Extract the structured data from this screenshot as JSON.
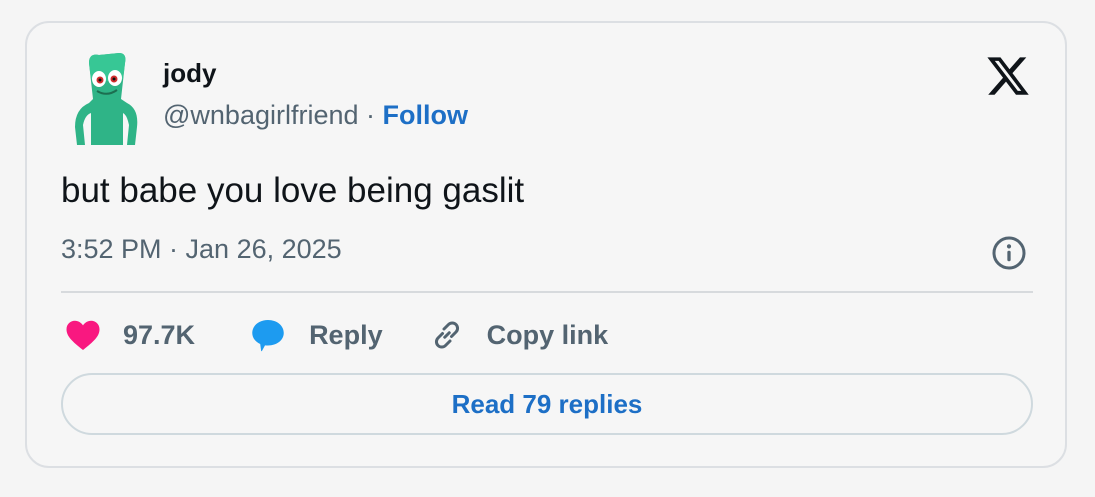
{
  "author": {
    "name": "jody",
    "handle": "@wnbagirlfriend",
    "separator": "·",
    "follow_label": "Follow"
  },
  "tweet": {
    "text": "but babe you love being gaslit",
    "timestamp": "3:52 PM · Jan 26, 2025"
  },
  "actions": {
    "like_count": "97.7K",
    "reply_label": "Reply",
    "copy_label": "Copy link"
  },
  "read_replies_label": "Read 79 replies",
  "icons": {
    "brand": "x-logo-icon",
    "info": "info-icon",
    "like": "heart-icon",
    "reply": "speech-bubble-icon",
    "copy": "link-icon"
  },
  "colors": {
    "heart": "#f91880",
    "reply_bubble": "#1d9bf0",
    "link_blue": "#1d6fc6",
    "avatar_body": "#2fb487"
  }
}
